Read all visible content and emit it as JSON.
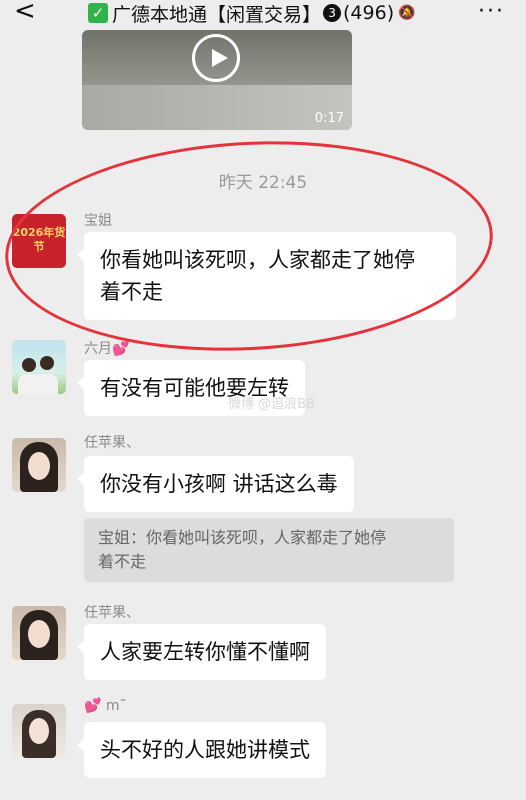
{
  "header": {
    "back_glyph": "<",
    "title_prefix": "广德本地通【闲置交易】",
    "unread_badge": "3",
    "member_count": "(496)",
    "more_glyph": "···"
  },
  "video": {
    "duration": "0:17"
  },
  "timestamp": "昨天 22:45",
  "messages": [
    {
      "sender": "宝姐",
      "text_line1": "你看她叫该死呗，人家都走了她停",
      "text_line2": "着不走",
      "avatar_text": "2026年货节"
    },
    {
      "sender": "六月",
      "text": "有没有可能他要左转"
    },
    {
      "sender": "任苹果、",
      "text": "你没有小孩啊 讲话这么毒"
    },
    {
      "sender": "任苹果、",
      "text": "人家要左转你懂不懂啊"
    },
    {
      "sender": "m˜",
      "text": "头不好的人跟她讲模式"
    }
  ],
  "quote": {
    "line1": "宝姐：你看她叫该死呗，人家都走了她停",
    "line2": "着不走"
  },
  "watermark": "微博 @追浪BB",
  "colors": {
    "bg": "#ededed",
    "bubble": "#ffffff",
    "highlight_ring": "#e5333b",
    "check_green": "#2fb34a"
  }
}
